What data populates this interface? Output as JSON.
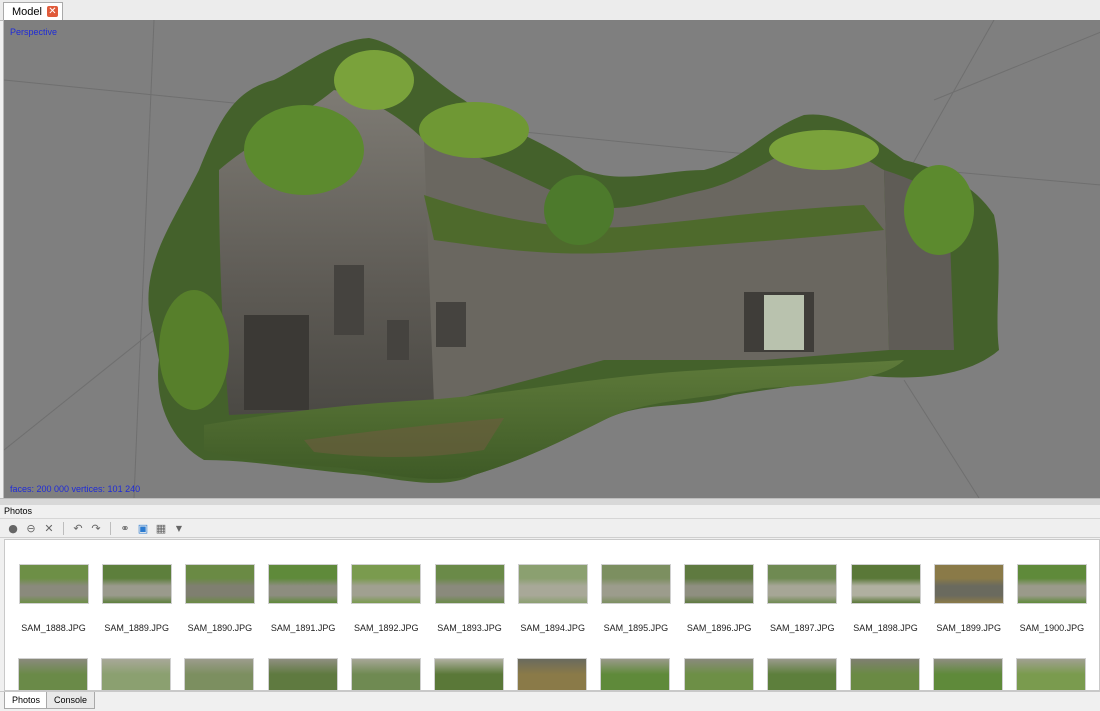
{
  "document_tab": {
    "label": "Model",
    "close_icon": "close-icon"
  },
  "viewport": {
    "projection_label": "Perspective",
    "stats": "faces: 200 000 vertices: 101 240",
    "background_color": "#7f7f7f",
    "overlay_text_color": "#1f2bd8"
  },
  "photos_panel": {
    "title": "Photos",
    "toolbar": [
      {
        "icon": "enable-camera-icon"
      },
      {
        "icon": "disable-camera-icon"
      },
      {
        "icon": "remove-photo-icon"
      },
      {
        "icon": "rotate-left-icon"
      },
      {
        "icon": "rotate-right-icon"
      },
      {
        "icon": "binoculars-icon"
      },
      {
        "icon": "reset-filter-icon"
      },
      {
        "icon": "thumbnail-view-icon"
      },
      {
        "icon": "dropdown-arrow-icon"
      }
    ],
    "photos": [
      {
        "name": "SAM_1888.JPG"
      },
      {
        "name": "SAM_1889.JPG"
      },
      {
        "name": "SAM_1890.JPG"
      },
      {
        "name": "SAM_1891.JPG"
      },
      {
        "name": "SAM_1892.JPG"
      },
      {
        "name": "SAM_1893.JPG"
      },
      {
        "name": "SAM_1894.JPG"
      },
      {
        "name": "SAM_1895.JPG"
      },
      {
        "name": "SAM_1896.JPG"
      },
      {
        "name": "SAM_1897.JPG"
      },
      {
        "name": "SAM_1898.JPG"
      },
      {
        "name": "SAM_1899.JPG"
      },
      {
        "name": "SAM_1900.JPG"
      }
    ],
    "second_row_count": 13
  },
  "bottom_tabs": [
    {
      "label": "Photos",
      "active": true
    },
    {
      "label": "Console",
      "active": false
    }
  ]
}
